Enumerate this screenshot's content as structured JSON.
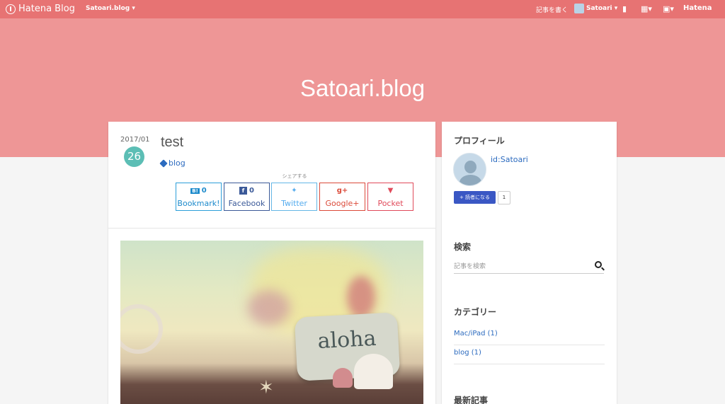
{
  "topbar": {
    "logo": "Hatena Blog",
    "blog_selector": "Satoari.blog ▾",
    "write_post": "記事を書く",
    "user": "Satoari ▾",
    "brand": "Hatena"
  },
  "header": {
    "title": "Satoari.blog"
  },
  "post": {
    "date_year_month": "2017/01",
    "date_day": "26",
    "title": "test",
    "tag": "blog",
    "share_label": "シェアする",
    "share_buttons": [
      {
        "name": "Bookmark!",
        "count": "0",
        "badge": "B!"
      },
      {
        "name": "Facebook",
        "count": "0",
        "badge": "f"
      },
      {
        "name": "Twitter",
        "count": "",
        "icon": "twitter-bird-icon"
      },
      {
        "name": "Google+",
        "count": "",
        "icon": "google-plus-icon"
      },
      {
        "name": "Pocket",
        "count": "",
        "icon": "pocket-icon"
      }
    ],
    "image_text": "aloha"
  },
  "sidebar": {
    "profile_heading": "プロフィール",
    "profile_id": "id:Satoari",
    "reader_button": "+ 読者になる",
    "reader_count": "1",
    "search_heading": "検索",
    "search_placeholder": "記事を検索",
    "category_heading": "カテゴリー",
    "categories": [
      {
        "label": "Mac/iPad (1)"
      },
      {
        "label": "blog (1)"
      }
    ],
    "recent_heading": "最新記事"
  },
  "colors": {
    "topbar": "#e77373",
    "header": "#ee9696",
    "date_badge": "#5cbeb5",
    "link": "#2c6bbf"
  }
}
